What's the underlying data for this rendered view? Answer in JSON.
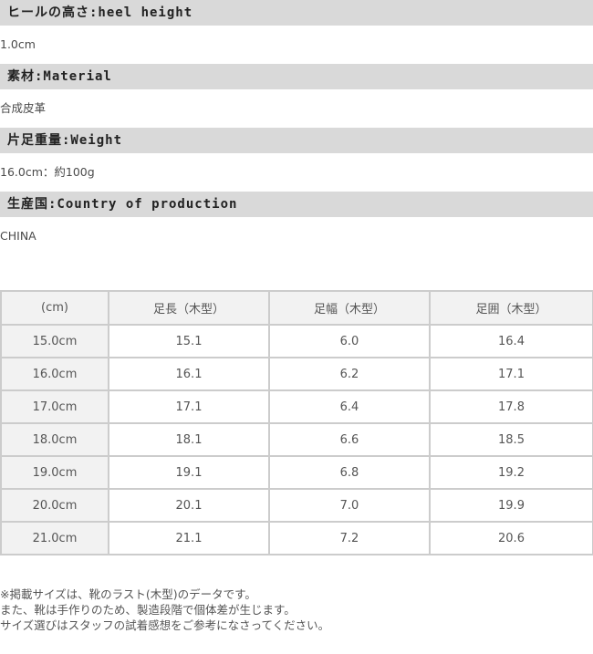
{
  "specs": [
    {
      "label": "ヒールの高さ:heel height",
      "value": "1.0cm"
    },
    {
      "label": "素材:Material",
      "value": "合成皮革"
    },
    {
      "label": "片足重量:Weight",
      "value": "16.0cm：約100g"
    },
    {
      "label": "生産国:Country of production",
      "value": "CHINA"
    }
  ],
  "size_table": {
    "headers": [
      "(cm)",
      "足長（木型）",
      "足幅（木型）",
      "足囲（木型）"
    ],
    "rows": [
      [
        "15.0cm",
        "15.1",
        "6.0",
        "16.4"
      ],
      [
        "16.0cm",
        "16.1",
        "6.2",
        "17.1"
      ],
      [
        "17.0cm",
        "17.1",
        "6.4",
        "17.8"
      ],
      [
        "18.0cm",
        "18.1",
        "6.6",
        "18.5"
      ],
      [
        "19.0cm",
        "19.1",
        "6.8",
        "19.2"
      ],
      [
        "20.0cm",
        "20.1",
        "7.0",
        "19.9"
      ],
      [
        "21.0cm",
        "21.1",
        "7.2",
        "20.6"
      ]
    ]
  },
  "notes": [
    "※掲載サイズは、靴のラスト(木型)のデータです。",
    "また、靴は手作りのため、製造段階で個体差が生じます。",
    "サイズ選びはスタッフの試着感想をご参考になさってください。"
  ]
}
